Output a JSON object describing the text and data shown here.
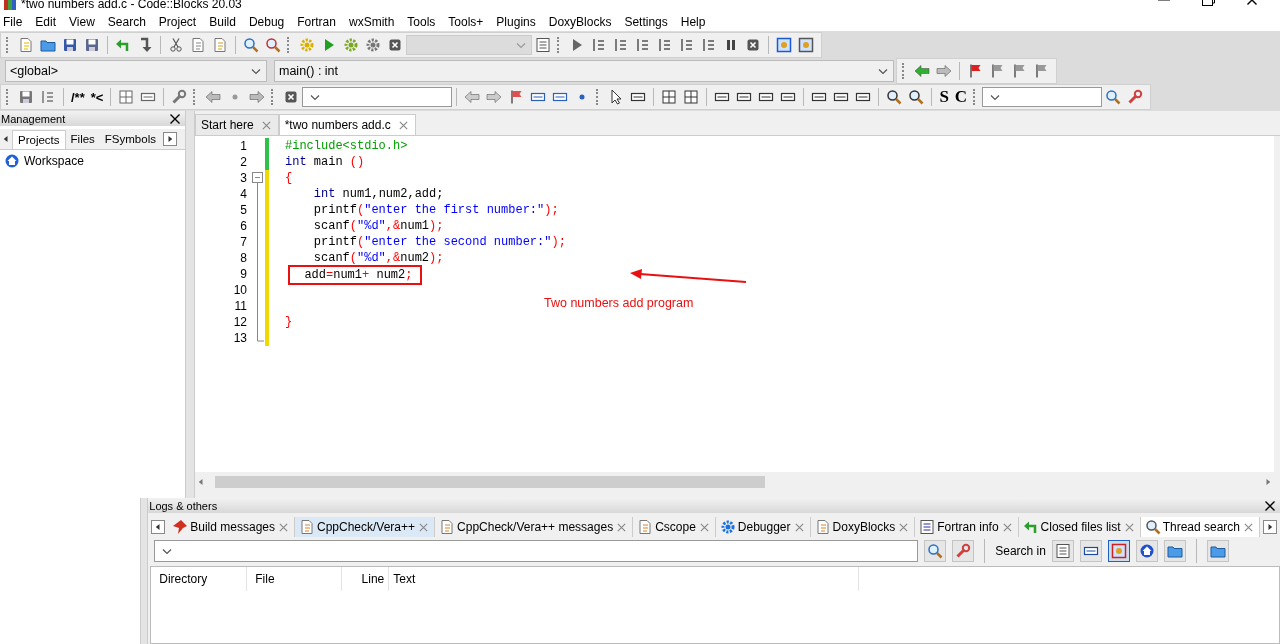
{
  "window": {
    "title": "*two numbers add.c - Code::Blocks 20.03"
  },
  "menu": [
    "File",
    "Edit",
    "View",
    "Search",
    "Project",
    "Build",
    "Debug",
    "Fortran",
    "wxSmith",
    "Tools",
    "Tools+",
    "Plugins",
    "DoxyBlocks",
    "Settings",
    "Help"
  ],
  "toolbar": {
    "comment_buttons": [
      "/**",
      "*<"
    ],
    "style_buttons": [
      "S",
      "C"
    ],
    "scope": "<global>",
    "function": "main() : int"
  },
  "management": {
    "title": "Management",
    "tabs": [
      {
        "label": "Projects",
        "selected": true
      },
      {
        "label": "Files",
        "selected": false
      },
      {
        "label": "FSymbols",
        "selected": false
      }
    ],
    "tree": [
      {
        "label": "Workspace"
      }
    ]
  },
  "editor": {
    "tabs": [
      {
        "label": "Start here",
        "selected": false
      },
      {
        "label": "*two numbers add.c",
        "selected": true
      }
    ],
    "lines": [
      {
        "number": "1",
        "modified": false,
        "boxed": false,
        "tokens": [
          {
            "kind": "pre",
            "text": "#include<stdio.h>"
          }
        ]
      },
      {
        "number": "2",
        "modified": false,
        "boxed": false,
        "tokens": [
          {
            "kind": "kw",
            "text": "int"
          },
          {
            "kind": "id",
            "text": " main "
          },
          {
            "kind": "op",
            "text": "()"
          }
        ]
      },
      {
        "number": "3",
        "modified": true,
        "boxed": false,
        "tokens": [
          {
            "kind": "op",
            "text": "{"
          }
        ]
      },
      {
        "number": "4",
        "modified": true,
        "boxed": false,
        "tokens": [
          {
            "kind": "kw",
            "text": "    int"
          },
          {
            "kind": "id",
            "text": " num1,num2,add;"
          }
        ]
      },
      {
        "number": "5",
        "modified": true,
        "boxed": false,
        "tokens": [
          {
            "kind": "id",
            "text": "    printf"
          },
          {
            "kind": "op",
            "text": "("
          },
          {
            "kind": "str",
            "text": "\"enter the first number:\""
          },
          {
            "kind": "op",
            "text": ");"
          }
        ]
      },
      {
        "number": "6",
        "modified": true,
        "boxed": false,
        "tokens": [
          {
            "kind": "id",
            "text": "    scanf"
          },
          {
            "kind": "op",
            "text": "("
          },
          {
            "kind": "str",
            "text": "\"%d\""
          },
          {
            "kind": "op",
            "text": ",&"
          },
          {
            "kind": "id",
            "text": "num1"
          },
          {
            "kind": "op",
            "text": ");"
          }
        ]
      },
      {
        "number": "7",
        "modified": true,
        "boxed": false,
        "tokens": [
          {
            "kind": "id",
            "text": "    printf"
          },
          {
            "kind": "op",
            "text": "("
          },
          {
            "kind": "str",
            "text": "\"enter the second number:\""
          },
          {
            "kind": "op",
            "text": ");"
          }
        ]
      },
      {
        "number": "8",
        "modified": true,
        "boxed": false,
        "tokens": [
          {
            "kind": "id",
            "text": "    scanf"
          },
          {
            "kind": "op",
            "text": "("
          },
          {
            "kind": "str",
            "text": "\"%d\""
          },
          {
            "kind": "op",
            "text": ",&"
          },
          {
            "kind": "id",
            "text": "num2"
          },
          {
            "kind": "op",
            "text": ");"
          }
        ]
      },
      {
        "number": "9",
        "modified": true,
        "boxed": true,
        "tokens": [
          {
            "kind": "id",
            "text": "  add"
          },
          {
            "kind": "op",
            "text": "="
          },
          {
            "kind": "id",
            "text": "num1"
          },
          {
            "kind": "op",
            "text": "+"
          },
          {
            "kind": "id",
            "text": " num2"
          },
          {
            "kind": "op",
            "text": ";"
          }
        ]
      },
      {
        "number": "10",
        "modified": true
      },
      {
        "number": "11",
        "modified": true
      },
      {
        "number": "12",
        "modified": true,
        "boxed": false,
        "tokens": [
          {
            "kind": "op",
            "text": "}"
          }
        ]
      },
      {
        "number": "13",
        "modified": true
      }
    ],
    "annotation": "Two numbers add program"
  },
  "logs": {
    "title": "Logs & others",
    "tabs": [
      {
        "label": "Build messages",
        "selected": false,
        "hovered": false
      },
      {
        "label": "CppCheck/Vera++",
        "selected": false,
        "hovered": true
      },
      {
        "label": "CppCheck/Vera++ messages",
        "selected": false,
        "hovered": false
      },
      {
        "label": "Cscope",
        "selected": false,
        "hovered": false
      },
      {
        "label": "Debugger",
        "selected": false,
        "hovered": false
      },
      {
        "label": "DoxyBlocks",
        "selected": false,
        "hovered": false
      },
      {
        "label": "Fortran info",
        "selected": false,
        "hovered": false
      },
      {
        "label": "Closed files list",
        "selected": false,
        "hovered": false
      },
      {
        "label": "Thread search",
        "selected": true,
        "hovered": false
      }
    ],
    "search_in_label": "Search in",
    "search_in_buttons": [
      {
        "on": false
      },
      {
        "on": false
      },
      {
        "on": true
      },
      {
        "on": false
      },
      {
        "on": false
      },
      {
        "on": false
      }
    ],
    "columns": [
      "Directory",
      "File",
      "Line",
      "Text"
    ]
  }
}
